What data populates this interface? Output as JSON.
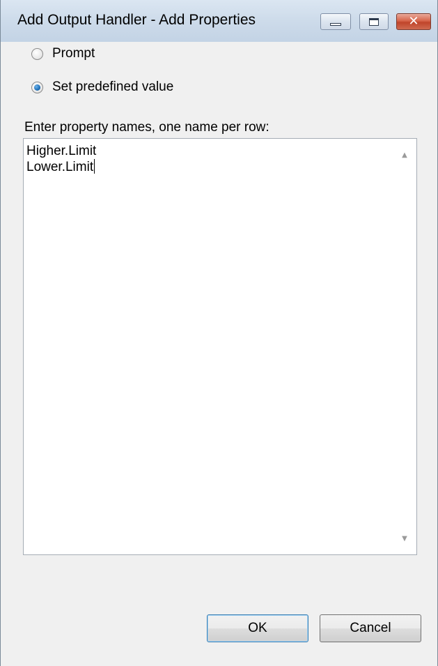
{
  "window": {
    "title": "Add Output Handler - Add Properties"
  },
  "options": {
    "prompt_label": "Prompt",
    "predefined_label": "Set predefined value",
    "selected": "Set predefined value"
  },
  "property_names": {
    "label": "Enter property names, one name per row:",
    "lines": [
      "Higher.Limit",
      "Lower.Limit"
    ]
  },
  "buttons": {
    "ok_label": "OK",
    "cancel_label": "Cancel"
  },
  "icons": {
    "minimize": "minimize-icon",
    "maximize": "maximize-icon",
    "close": "close-icon",
    "scroll_up": "scroll-up-arrow-icon",
    "scroll_down": "scroll-down-arrow-icon"
  },
  "colors": {
    "title_bar": "#cddbea",
    "close_button": "#c0452b",
    "ok_border": "#3c7fb1",
    "radio_selected": "#1e6fb8"
  }
}
